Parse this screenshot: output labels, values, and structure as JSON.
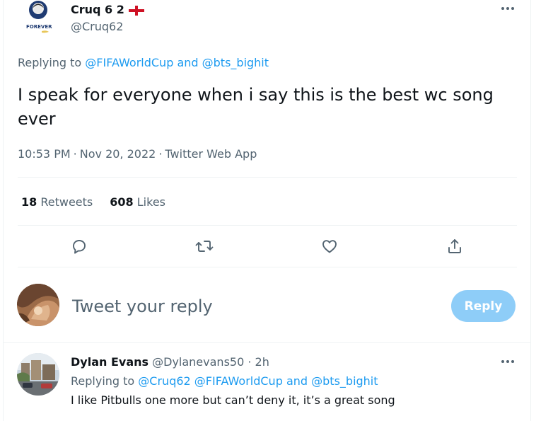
{
  "tweet": {
    "author": {
      "display_name": "Cruq 6 2",
      "flag_icon": "england-flag-icon",
      "handle": "@Cruq62",
      "avatar_text": "FOREVER MI"
    },
    "replying_to": {
      "prefix": "Replying to",
      "mentions": [
        "@FIFAWorldCup",
        "@bts_bighit"
      ],
      "joiner": "and"
    },
    "text_line1": "I speak for everyone when i say this is the best wc song",
    "text_line2": "ever",
    "time": "10:53 PM",
    "date": "Nov 20, 2022",
    "source": "Twitter Web App",
    "separator": "·",
    "stats": {
      "retweets_count": "18",
      "retweets_label": "Retweets",
      "likes_count": "608",
      "likes_label": "Likes"
    },
    "actions": [
      "reply-icon",
      "retweet-icon",
      "like-icon",
      "share-icon"
    ]
  },
  "composer": {
    "placeholder": "Tweet your reply",
    "reply_label": "Reply",
    "button_color": "#8ecdf8"
  },
  "reply": {
    "display_name": "Dylan Evans",
    "handle": "@Dylanevans50",
    "separator": "·",
    "time": "2h",
    "replying_prefix": "Replying to",
    "mention1": "@Cruq62",
    "mention2": "@FIFAWorldCup",
    "joiner": "and",
    "mention3": "@bts_bighit",
    "text": "I like Pitbulls one more but can’t deny it, it’s a great song"
  },
  "colors": {
    "accent": "#1d9bf0",
    "muted": "#536471",
    "text": "#0f1419",
    "divider": "#eff3f4"
  }
}
